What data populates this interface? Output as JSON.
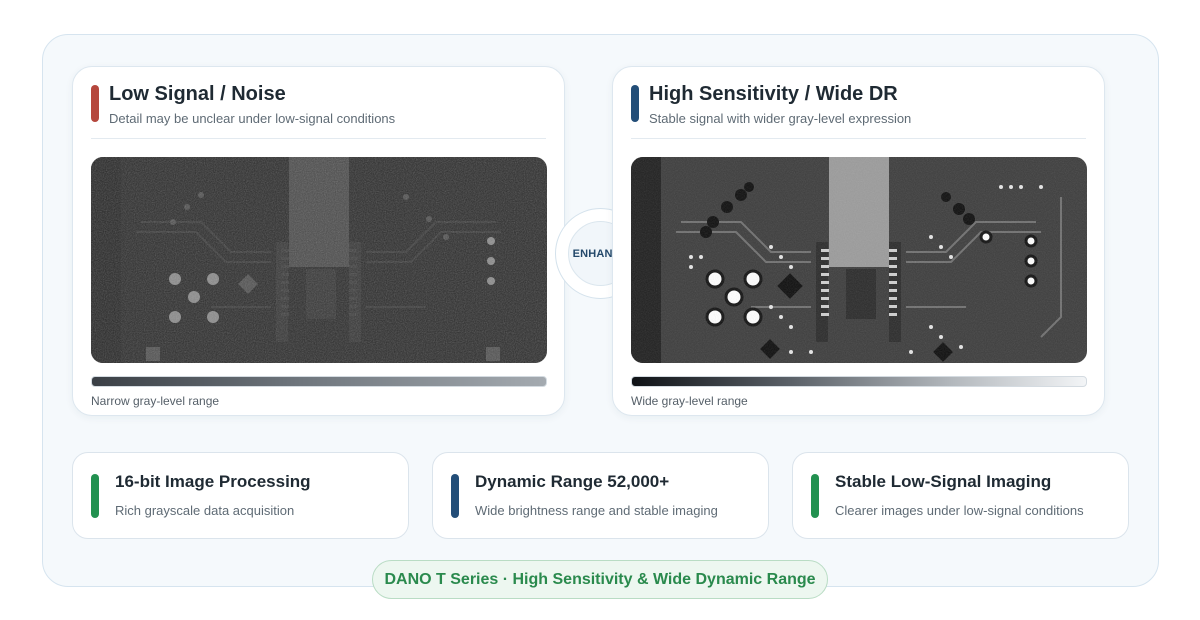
{
  "colors": {
    "red_accent": "#b5473d",
    "blue_accent": "#234e78",
    "green_accent": "#229150",
    "tag_green": "#2a8a4d"
  },
  "left_panel": {
    "title": "Low Signal / Noise",
    "subtitle": "Detail may be unclear under low-signal conditions",
    "range_label": "Narrow gray-level range"
  },
  "right_panel": {
    "title": "High Sensitivity / Wide DR",
    "subtitle": "Stable signal with wider gray-level expression",
    "range_label": "Wide gray-level range"
  },
  "center": {
    "enhance_label": "ENHANCE"
  },
  "features": [
    {
      "title": "16-bit Image Processing",
      "description": "Rich grayscale data acquisition"
    },
    {
      "title": "Dynamic Range 52,000+",
      "description": "Wide brightness range and stable imaging"
    },
    {
      "title": "Stable Low-Signal Imaging",
      "description": "Clearer images under low-signal conditions"
    }
  ],
  "tagline": "DANO T Series · High Sensitivity & Wide Dynamic Range"
}
